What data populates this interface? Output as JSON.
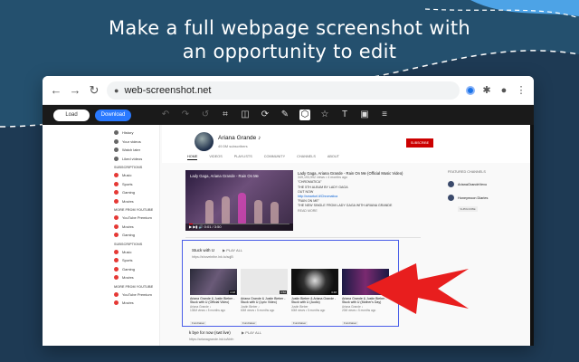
{
  "headline": {
    "line1": "Make a full webpage screenshot with",
    "line2": "an opportunity to edit"
  },
  "browser": {
    "url": "web-screenshot.net",
    "nav": {
      "back": "←",
      "forward": "→",
      "reload": "↻",
      "lock": "🔒"
    },
    "extensions": {
      "puzzle": "✱",
      "account": "●",
      "menu": "⋮"
    }
  },
  "editor_toolbar": {
    "load_label": "Load",
    "download_label": "Download",
    "tools": [
      {
        "name": "undo",
        "glyph": "↶",
        "lit": false
      },
      {
        "name": "redo",
        "glyph": "↷",
        "lit": false
      },
      {
        "name": "reset",
        "glyph": "↺",
        "lit": false
      },
      {
        "name": "crop",
        "glyph": "⌗",
        "lit": true
      },
      {
        "name": "flip",
        "glyph": "◫",
        "lit": true
      },
      {
        "name": "rotate",
        "glyph": "⟳",
        "lit": true
      },
      {
        "name": "draw",
        "glyph": "✎",
        "lit": true
      },
      {
        "name": "shape",
        "glyph": "⬡",
        "lit": true
      },
      {
        "name": "icon",
        "glyph": "☆",
        "lit": true
      },
      {
        "name": "text",
        "glyph": "T",
        "lit": true
      },
      {
        "name": "mask",
        "glyph": "▣",
        "lit": true
      },
      {
        "name": "filter",
        "glyph": "≡",
        "lit": true
      }
    ]
  },
  "youtube": {
    "sidebar": {
      "top_items": [
        "History",
        "Your videos",
        "Watch later",
        "Liked videos"
      ],
      "section1": "SUBSCRIPTIONS",
      "sub_items": [
        "Music",
        "Sports",
        "Gaming",
        "Movies"
      ],
      "section2": "MORE FROM YOUTUBE",
      "more_items": [
        "YouTube Premium",
        "Movies",
        "Gaming"
      ],
      "section3": "SUBSCRIPTIONS",
      "sub_items2": [
        "Music",
        "Sports",
        "Gaming",
        "Movies"
      ],
      "section4": "MORE FROM YOUTUBE",
      "more_items2": [
        "YouTube Premium",
        "Movies"
      ]
    },
    "channel": {
      "name": "Ariana Grande ♪",
      "subscribers": "49.5M subscribers",
      "subscribe": "SUBSCRIBE",
      "tabs": [
        "HOME",
        "VIDEOS",
        "PLAYLISTS",
        "COMMUNITY",
        "CHANNELS",
        "ABOUT"
      ]
    },
    "video": {
      "overlay_title": "Lady Gaga, Ariana Grande - Rain On Me",
      "time": "0:01 / 3:50",
      "title": "Lady Gaga, Ariana Grande - Rain On Me (Official Music Video)",
      "meta": "349,193,992 views • 4 months ago",
      "lines": [
        "\"CHROMATICA\"",
        "THE 5TH ALBUM BY LADY GAGA",
        "OUT NOW"
      ],
      "link1": "http://smarturl.it/Chromatica",
      "lines2": [
        "\"RAIN ON ME\"",
        "THE NEW SINGLE FROM LADY GAGA WITH ARIANA GRANDE"
      ],
      "read_more": "READ MORE"
    },
    "featured": {
      "title": "FEATURED CHANNELS",
      "channels": [
        "ArianaGrandeVevo",
        "Honeymoon Diaries"
      ],
      "subscribe": "SUBSCRIBE"
    },
    "playlist": {
      "title": "Stuck with U",
      "play_all": "PLAY ALL",
      "url": "https://shovelnthe.lnk.to/sqjB",
      "items": [
        {
          "title": "Ariana Grande & Justin Bieber - Stuck with U (Official Video)",
          "channel": "Ariana Grande ♪",
          "views": "135M views • 5 months ago",
          "tag": "Fundraiser",
          "duration": "4:18"
        },
        {
          "title": "Ariana Grande & Justin Bieber - Stuck with U (Lyric Video)",
          "channel": "Justin Bieber ♪",
          "views": "60M views • 5 months ago",
          "tag": "Fundraiser",
          "duration": "3:50"
        },
        {
          "title": "Justin Bieber & Ariana Grande - Stuck with U (Audio)",
          "channel": "Justin Bieber",
          "views": "60M views • 5 months ago",
          "tag": "Fundraiser",
          "duration": "3:48"
        },
        {
          "title": "Ariana Grande & Justin Bieber - Stuck with U (Mother's Day)",
          "channel": "Ariana Grande ♪",
          "views": "20M views • 5 months ago",
          "tag": "Fundraiser",
          "duration": "4:23"
        }
      ]
    },
    "playlist2": {
      "title": "k bye for now (swt live)",
      "play_all": "PLAY ALL",
      "url": "https://arianagrande.lnk.to/kbfn"
    }
  },
  "colors": {
    "highlight_border": "#4a5ee8",
    "arrow": "#e81e1e",
    "download": "#2979ff",
    "subscribe": "#cc0000"
  }
}
